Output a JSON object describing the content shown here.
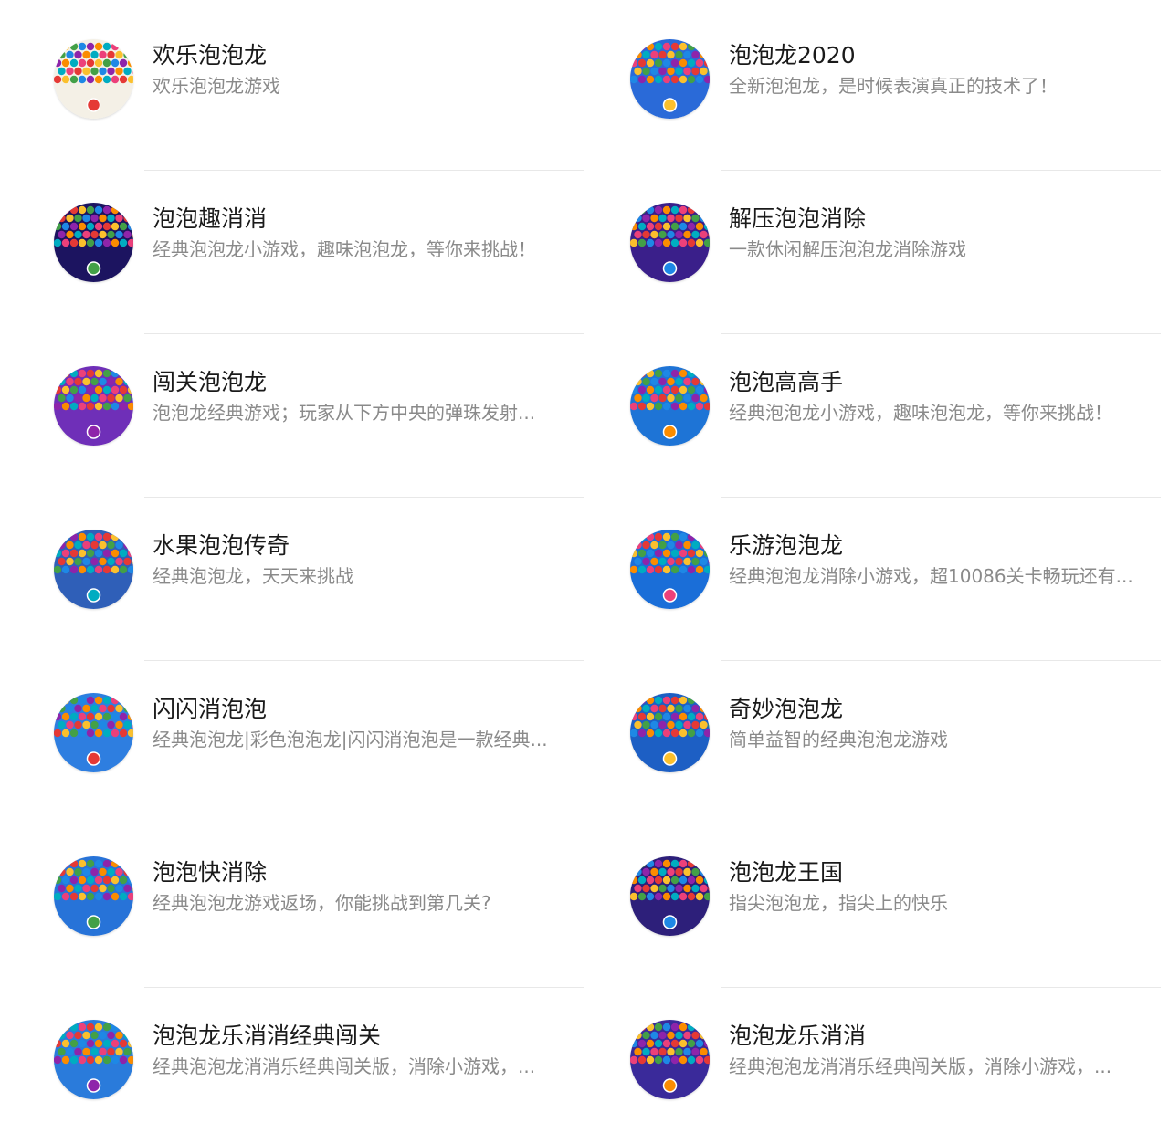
{
  "games": [
    {
      "title": "欢乐泡泡龙",
      "desc": "欢乐泡泡龙游戏",
      "icon": "bubble-wheel-icon",
      "bg": "#f4f0e6"
    },
    {
      "title": "泡泡龙2020",
      "desc": "全新泡泡龙，是时候表演真正的技术了！",
      "icon": "bubble-cluster-icon",
      "bg": "#2a6ad8"
    },
    {
      "title": "泡泡趣消消",
      "desc": "经典泡泡龙小游戏，趣味泡泡龙，等你来挑战！",
      "icon": "bubble-dark-icon",
      "bg": "#1c1460"
    },
    {
      "title": "解压泡泡消除",
      "desc": "一款休闲解压泡泡龙消除游戏",
      "icon": "bubble-diagonal-icon",
      "bg": "#3a1f8a"
    },
    {
      "title": "闯关泡泡龙",
      "desc": "泡泡龙经典游戏；玩家从下方中央的弹珠发射...",
      "icon": "bubble-star-icon",
      "bg": "#6f2fb8"
    },
    {
      "title": "泡泡高高手",
      "desc": "经典泡泡龙小游戏，趣味泡泡龙，等你来挑战！",
      "icon": "bubble-vshape-icon",
      "bg": "#1e74d6"
    },
    {
      "title": "水果泡泡传奇",
      "desc": "经典泡泡龙，天天来挑战",
      "icon": "fruit-bubble-icon",
      "bg": "#2f5fb8"
    },
    {
      "title": "乐游泡泡龙",
      "desc": "经典泡泡龙消除小游戏，超10086关卡畅玩还有...",
      "icon": "bubble-arc-icon",
      "bg": "#1a6ed8"
    },
    {
      "title": "闪闪消泡泡",
      "desc": "经典泡泡龙|彩色泡泡龙|闪闪消泡泡是一款经典...",
      "icon": "bubble-sparkle-icon",
      "bg": "#2e7ee0"
    },
    {
      "title": "奇妙泡泡龙",
      "desc": "简单益智的经典泡泡龙游戏",
      "icon": "bubble-swirl-icon",
      "bg": "#1d5fc4"
    },
    {
      "title": "泡泡快消除",
      "desc": "经典泡泡龙游戏返场，你能挑战到第几关?",
      "icon": "bubble-aim-icon",
      "bg": "#2773d8"
    },
    {
      "title": "泡泡龙王国",
      "desc": "指尖泡泡龙，指尖上的快乐",
      "icon": "bubble-kingdom-icon",
      "bg": "#2d1f7a"
    },
    {
      "title": "泡泡龙乐消消经典闯关",
      "desc": "经典泡泡龙消消乐经典闯关版，消除小游戏，...",
      "icon": "bubble-shooter-icon",
      "bg": "#2a7bdb"
    },
    {
      "title": "泡泡龙乐消消",
      "desc": "经典泡泡龙消消乐经典闯关版，消除小游戏，...",
      "icon": "bubble-purple-icon",
      "bg": "#3a2a9a"
    }
  ]
}
